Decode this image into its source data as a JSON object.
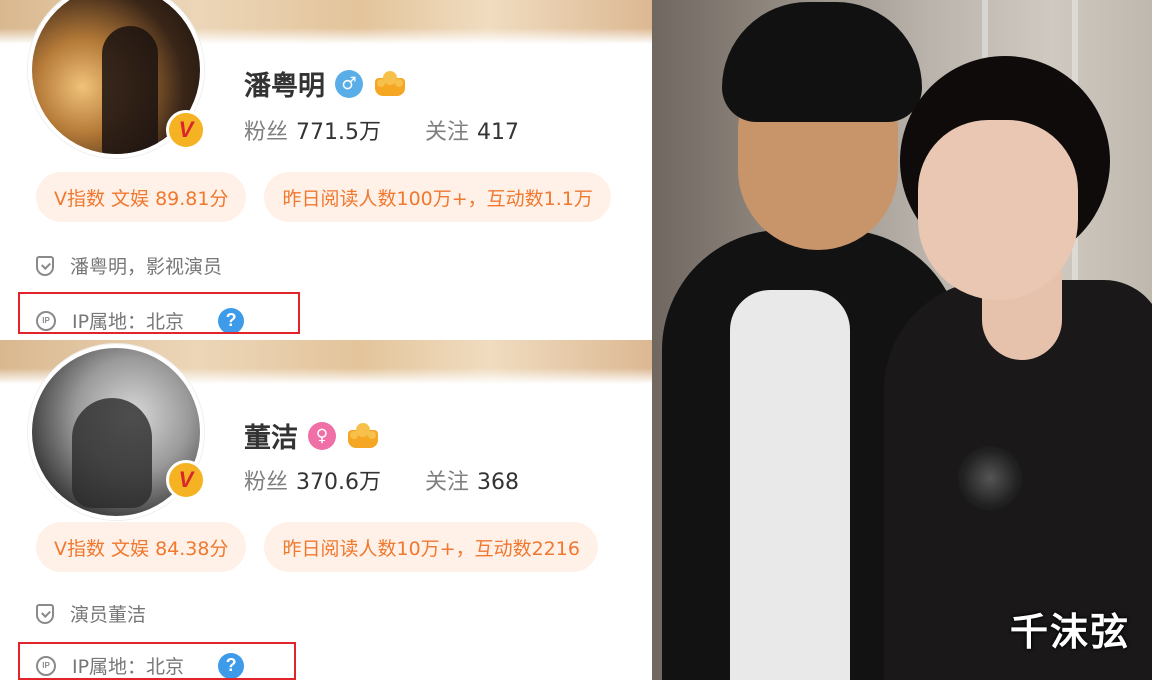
{
  "profiles": [
    {
      "name": "潘粤明",
      "gender_icon": "♂",
      "fans_label": "粉丝",
      "fans_value": "771.5万",
      "follow_label": "关注",
      "follow_value": "417",
      "pill_index": "V指数 文娱 89.81分",
      "pill_reads": "昨日阅读人数100万+，互动数1.1万",
      "description": "潘粤明，影视演员",
      "ip_icon_text": "IP",
      "ip_location": "IP属地：北京",
      "help_text": "?",
      "verified_text": "V"
    },
    {
      "name": "董洁",
      "gender_icon": "♀",
      "fans_label": "粉丝",
      "fans_value": "370.6万",
      "follow_label": "关注",
      "follow_value": "368",
      "pill_index": "V指数 文娱 84.38分",
      "pill_reads": "昨日阅读人数10万+，互动数2216",
      "description": "演员董洁",
      "ip_icon_text": "IP",
      "ip_location": "IP属地：北京",
      "help_text": "?",
      "verified_text": "V"
    }
  ],
  "photo": {
    "watermark": "千沫弦"
  },
  "colors": {
    "accent_orange": "#f0782f",
    "pill_bg": "#fff1e8",
    "highlight_red": "#e0242a",
    "help_blue": "#3d9be9",
    "male_blue": "#5aaee8",
    "female_pink": "#f06fa7"
  }
}
